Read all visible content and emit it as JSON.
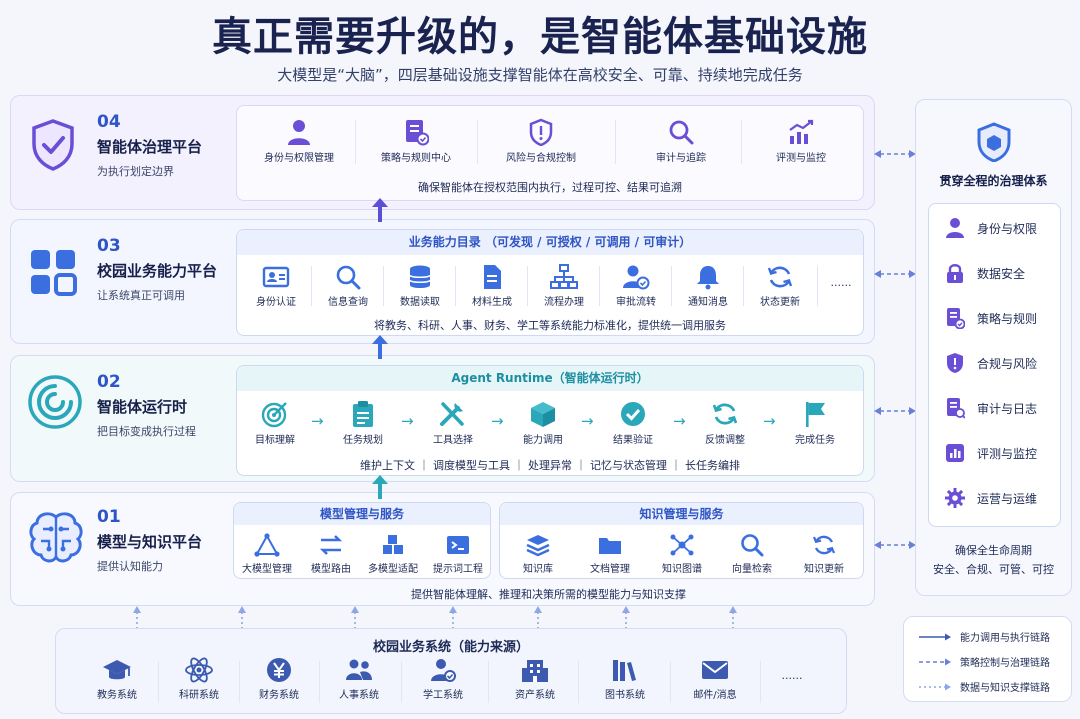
{
  "title": "真正需要升级的，是智能体基础设施",
  "subtitle": "大模型是“大脑”，四层基础设施支撑智能体在高校安全、可靠、持续地完成任务",
  "layer4": {
    "num": "04",
    "name": "智能体治理平台",
    "desc": "为执行划定边界",
    "items": [
      "身份与权限管理",
      "策略与规则中心",
      "风险与合规控制",
      "审计与追踪",
      "评测与监控"
    ],
    "footer": "确保智能体在授权范围内执行，过程可控、结果可追溯"
  },
  "layer3": {
    "num": "03",
    "name": "校园业务能力平台",
    "desc": "让系统真正可调用",
    "header": "业务能力目录 （可发现 / 可授权 / 可调用 / 可审计）",
    "items": [
      "身份认证",
      "信息查询",
      "数据读取",
      "材料生成",
      "流程办理",
      "审批流转",
      "通知消息",
      "状态更新"
    ],
    "more": "......",
    "footer": "将教务、科研、人事、财务、学工等系统能力标准化，提供统一调用服务"
  },
  "layer2": {
    "num": "02",
    "name": "智能体运行时",
    "desc": "把目标变成执行过程",
    "header": "Agent Runtime（智能体运行时）",
    "items": [
      "目标理解",
      "任务规划",
      "工具选择",
      "能力调用",
      "结果验证",
      "反馈调整",
      "完成任务"
    ],
    "footer": "维护上下文  ｜  调度模型与工具  ｜  处理异常  ｜  记忆与状态管理  ｜  长任务编排"
  },
  "layer1": {
    "num": "01",
    "name": "模型与知识平台",
    "desc": "提供认知能力",
    "model_header": "模型管理与服务",
    "model_items": [
      "大模型管理",
      "模型路由",
      "多模型适配",
      "提示词工程"
    ],
    "knowledge_header": "知识管理与服务",
    "knowledge_items": [
      "知识库",
      "文档管理",
      "知识图谱",
      "向量检索",
      "知识更新"
    ],
    "footer": "提供智能体理解、推理和决策所需的模型能力与知识支撑"
  },
  "sources": {
    "header": "校园业务系统（能力来源）",
    "items": [
      "教务系统",
      "科研系统",
      "财务系统",
      "人事系统",
      "学工系统",
      "资产系统",
      "图书系统",
      "邮件/消息"
    ],
    "more": "......"
  },
  "governance": {
    "title": "贯穿全程的治理体系",
    "items": [
      "身份与权限",
      "数据安全",
      "策略与规则",
      "合规与风险",
      "审计与日志",
      "评测与监控",
      "运营与运维"
    ],
    "footer1": "确保全生命周期",
    "footer2": "安全、合规、可管、可控"
  },
  "legend": {
    "items": [
      "能力调用与执行链路",
      "策略控制与治理链路",
      "数据与知识支撑链路"
    ]
  },
  "colors": {
    "accent": "#2e55c8",
    "icon": "#3b6fe0",
    "purple": "#6a4fd6"
  }
}
